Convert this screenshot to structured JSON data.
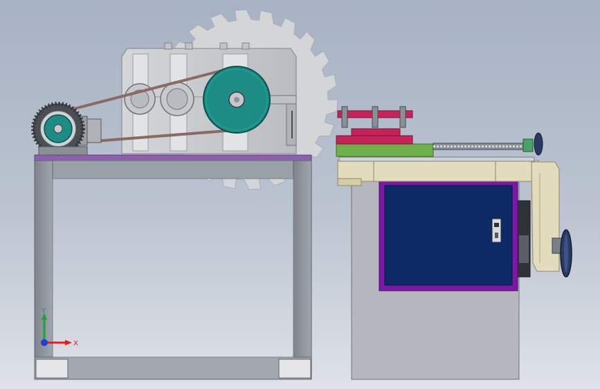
{
  "view": {
    "triad": {
      "x_label": "X",
      "y_label": "Y",
      "x_color": "#e0201c",
      "y_color": "#1aa33a",
      "z_color": "#1f3fd6"
    }
  },
  "colors": {
    "background_top": "#a7b2c3",
    "frame_gray": "#8e939b",
    "frame_dark": "#6c7079",
    "tabletop_purple": "#8f5fb2",
    "gearbox_gray": "#c9cbce",
    "pulley_teal": "#1c8c84",
    "saw_blade": "#d3d5d8",
    "belt_brown": "#8a6a62",
    "cabinet_blue": "#0e2a66",
    "cabinet_border": "#7c17a6",
    "rail_tan": "#e2dcbc",
    "slide_green": "#6eb04a",
    "clamp_red": "#c4245a",
    "handwheel_navy": "#2a3b63"
  },
  "components": [
    "left-machine-frame",
    "gearbox",
    "saw-blade",
    "large-pulley",
    "motor-with-small-pulley",
    "v-belt",
    "right-base-cabinet",
    "cabinet-door",
    "feed-rail",
    "lead-screw",
    "workpiece-clamp",
    "handwheel"
  ]
}
